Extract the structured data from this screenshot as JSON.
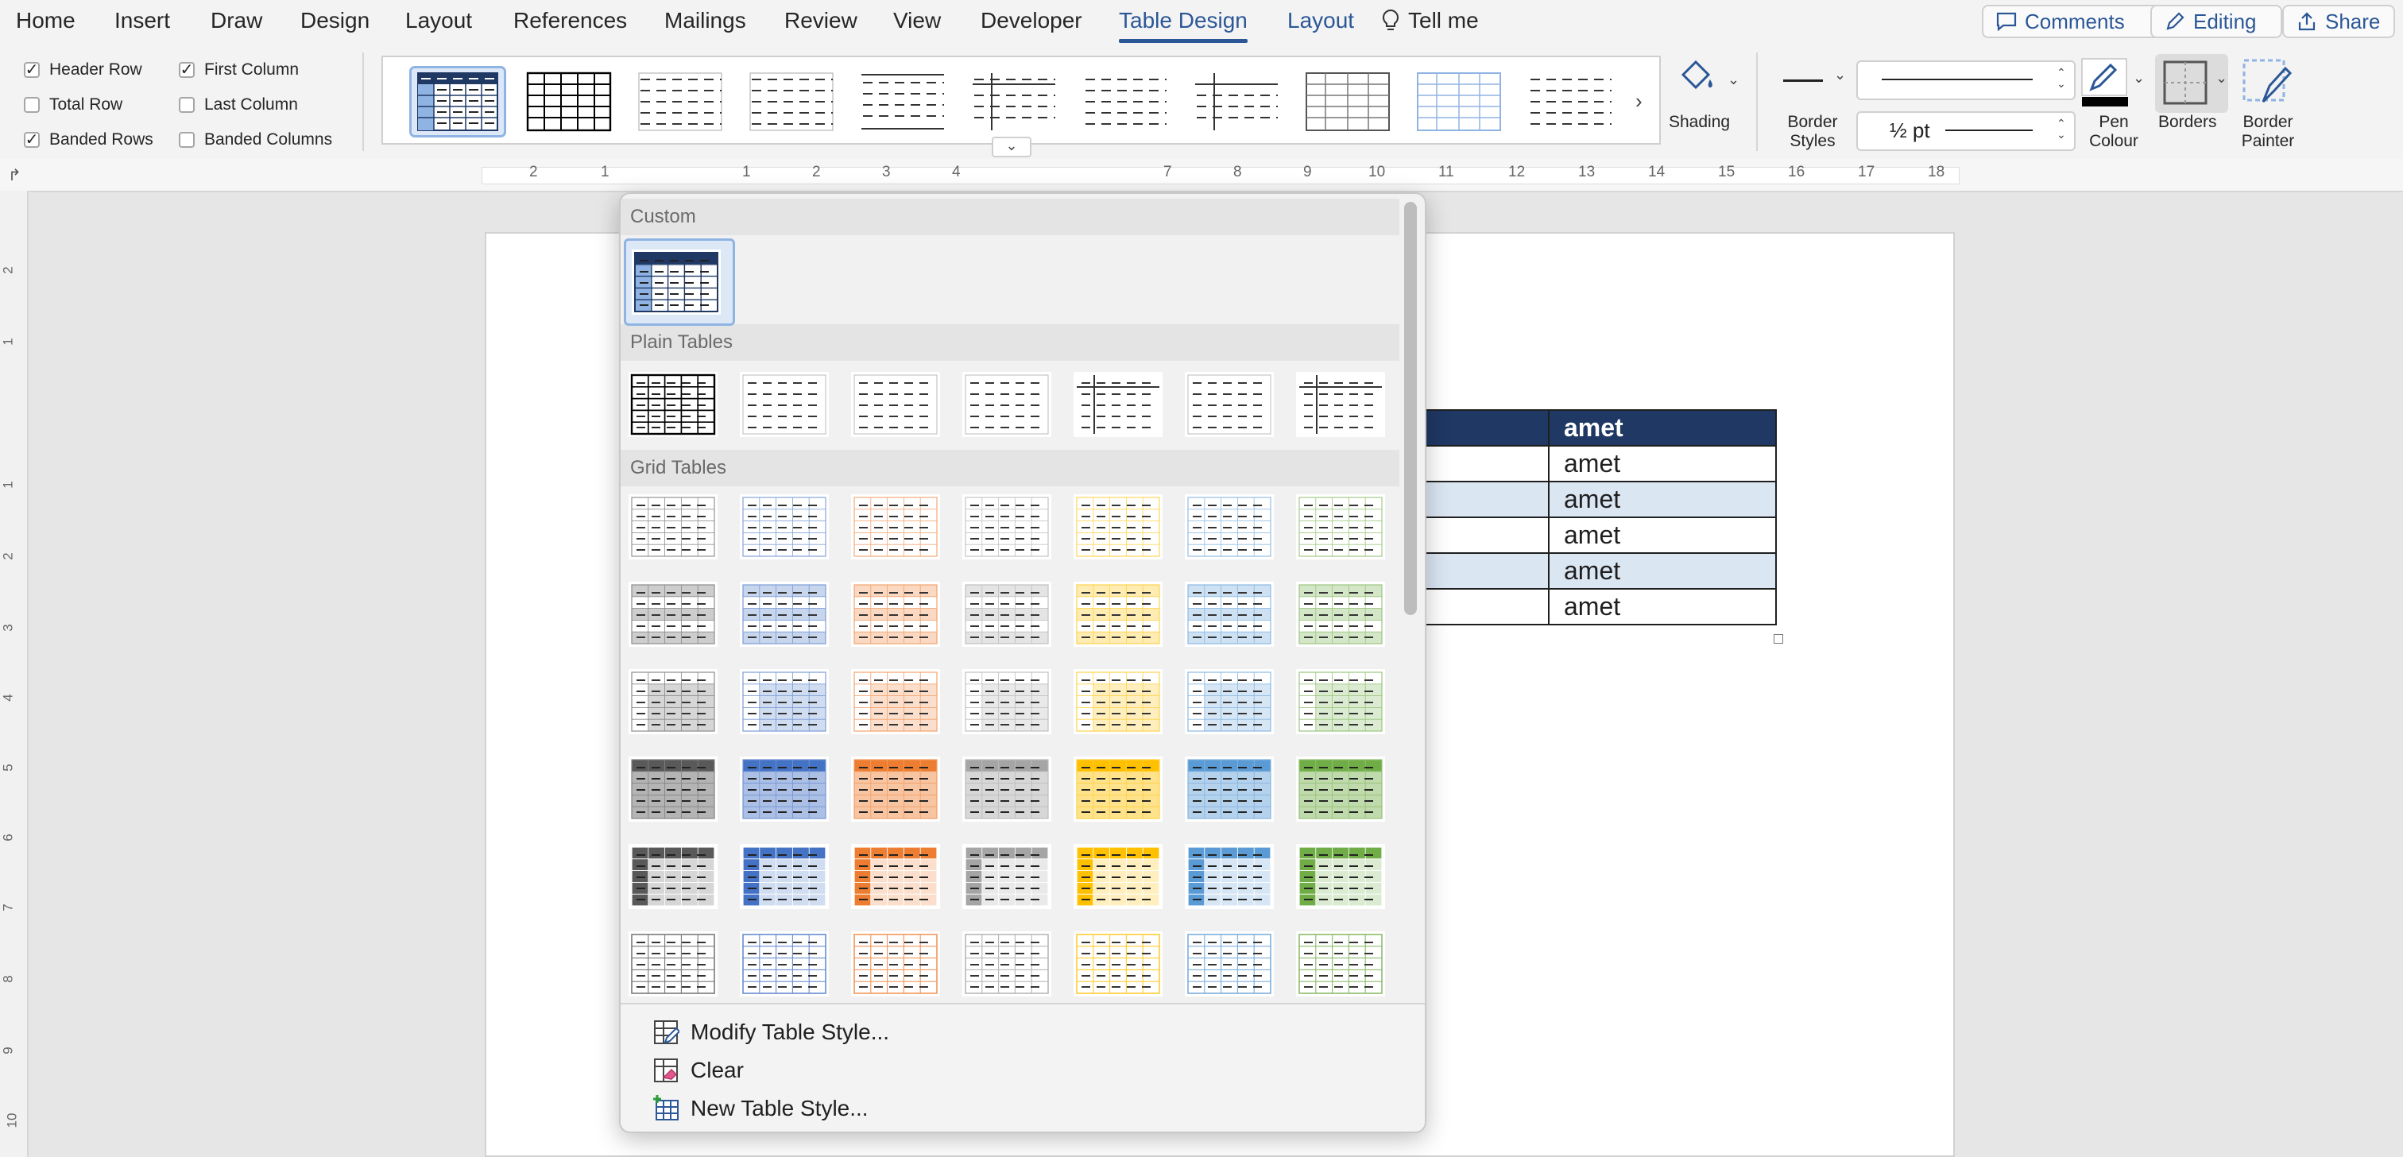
{
  "menubar": {
    "tabs": [
      {
        "label": "Home"
      },
      {
        "label": "Insert"
      },
      {
        "label": "Draw"
      },
      {
        "label": "Design"
      },
      {
        "label": "Layout"
      },
      {
        "label": "References"
      },
      {
        "label": "Mailings"
      },
      {
        "label": "Review"
      },
      {
        "label": "View"
      },
      {
        "label": "Developer"
      },
      {
        "label": "Table Design"
      },
      {
        "label": "Layout"
      },
      {
        "label": "Tell me"
      }
    ],
    "active_tab": "Table Design",
    "comments_label": "Comments",
    "editing_label": "Editing",
    "share_label": "Share"
  },
  "ribbon": {
    "style_options": [
      {
        "label": "Header Row",
        "checked": true
      },
      {
        "label": "Total Row",
        "checked": false
      },
      {
        "label": "Banded Rows",
        "checked": true
      },
      {
        "label": "First Column",
        "checked": true
      },
      {
        "label": "Last Column",
        "checked": false
      },
      {
        "label": "Banded Columns",
        "checked": false
      }
    ],
    "shading_label": "Shading",
    "border_styles_label": "Border Styles",
    "pen_weight": "½ pt",
    "pen_colour_label": "Pen Colour",
    "borders_label": "Borders",
    "border_painter_label": "Border Painter",
    "accent_color": "#2b5797"
  },
  "ruler": {
    "numbers": [
      "2",
      "1",
      "1",
      "2",
      "3",
      "4",
      "7",
      "8",
      "9",
      "10",
      "11",
      "12",
      "13",
      "14",
      "15",
      "16",
      "17",
      "18"
    ],
    "vertical_numbers": [
      "2",
      "1",
      "1",
      "2",
      "3",
      "4",
      "5",
      "6",
      "7",
      "8",
      "9",
      "10"
    ]
  },
  "document": {
    "table_rows": [
      {
        "header": true,
        "left": "",
        "right": "amet"
      },
      {
        "header": false,
        "left": "",
        "right": "amet"
      },
      {
        "header": false,
        "left": "",
        "right": "amet"
      },
      {
        "header": false,
        "left": "",
        "right": "amet"
      },
      {
        "header": false,
        "left": "",
        "right": "amet"
      },
      {
        "header": false,
        "left": "",
        "right": "amet"
      }
    ],
    "header_color": "#1f3864",
    "band_color": "#dbe6f3"
  },
  "dropdown": {
    "sections": [
      {
        "title": "Custom"
      },
      {
        "title": "Plain Tables"
      },
      {
        "title": "Grid Tables"
      }
    ],
    "modify_label": "Modify Table Style...",
    "clear_label": "Clear",
    "new_label": "New Table Style...",
    "grid_palette": [
      "#595959",
      "#4472c4",
      "#ed7d31",
      "#a5a5a5",
      "#ffc000",
      "#5b9bd5",
      "#70ad47"
    ]
  }
}
